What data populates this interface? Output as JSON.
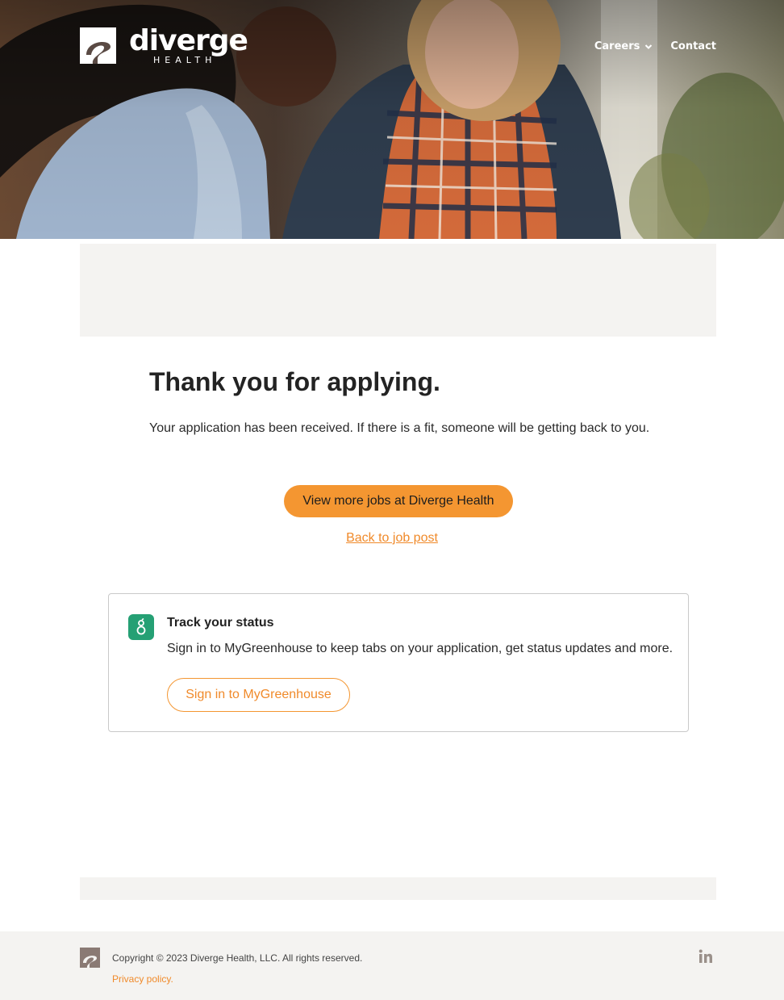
{
  "header": {
    "logo_word": "diverge",
    "logo_sub": "HEALTH",
    "nav": [
      {
        "label": "Careers",
        "icon": "chevron-down-icon"
      },
      {
        "label": "Contact"
      }
    ]
  },
  "main": {
    "title": "Thank you for applying.",
    "message": "Your application has been received. If there is a fit, someone will be getting back to you.",
    "cta_label": "View more jobs at Diverge Health",
    "back_link": "Back to job post"
  },
  "track": {
    "icon": "greenhouse-icon",
    "title": "Track your status",
    "description": "Sign in to MyGreenhouse to keep tabs on your application, get status updates and more.",
    "button_label": "Sign in to MyGreenhouse"
  },
  "footer": {
    "copyright": "Copyright © 2023 Diverge Health, LLC. All rights reserved.",
    "privacy": "Privacy policy.",
    "social_icon": "linkedin-icon"
  },
  "colors": {
    "accent": "#f49631",
    "link": "#f08a2a",
    "greenhouse": "#25a074",
    "panel": "#f4f3f1"
  }
}
